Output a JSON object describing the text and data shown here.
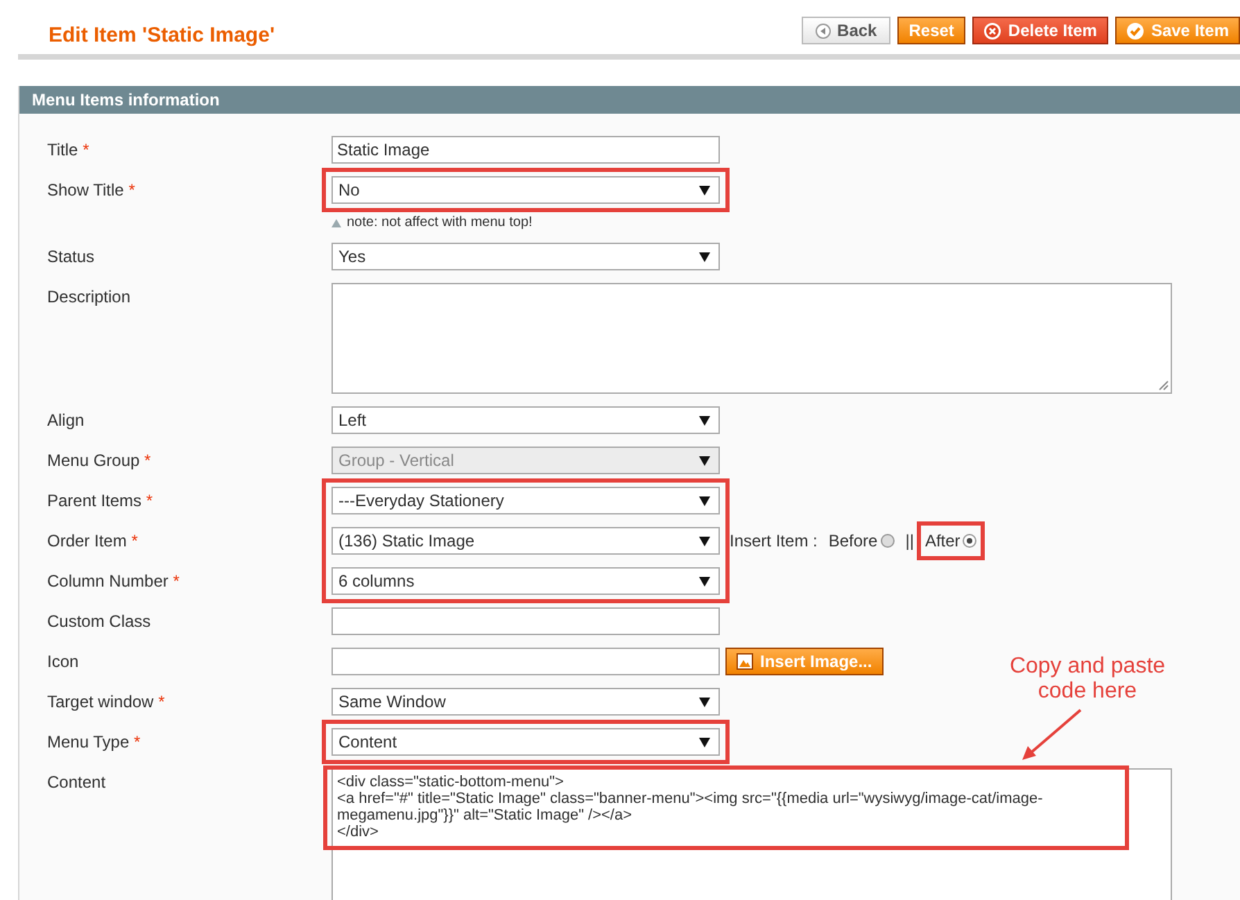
{
  "page": {
    "title": "Edit Item 'Static Image'"
  },
  "buttons": [
    {
      "label": "Back",
      "kind": "back"
    },
    {
      "label": "Reset",
      "kind": "reset"
    },
    {
      "label": "Delete Item",
      "kind": "delete"
    },
    {
      "label": "Save Item",
      "kind": "save"
    }
  ],
  "section": {
    "title": "Menu Items information"
  },
  "fields": [
    {
      "label": "Title",
      "mark": "*",
      "kind": "text",
      "value": "Static Image",
      "disabled": false,
      "highlighted": false
    },
    {
      "label": "Show Title",
      "mark": "*",
      "kind": "select",
      "value": "No",
      "disabled": false,
      "highlighted": true,
      "note": "note: not affect with menu top!"
    },
    {
      "label": "Status",
      "kind": "select",
      "value": "Yes",
      "disabled": false,
      "highlighted": false
    },
    {
      "label": "Description",
      "kind": "textarea",
      "disabled": false,
      "highlighted": false
    },
    {
      "label": "Align",
      "kind": "select",
      "value": "Left",
      "disabled": false,
      "highlighted": false
    },
    {
      "label": "Menu Group",
      "mark": "*",
      "kind": "select",
      "value": "Group - Vertical",
      "disabled": true,
      "highlighted": false
    },
    {
      "label": "Parent Items",
      "mark": "*",
      "kind": "select",
      "value": "---Everyday Stationery",
      "disabled": false,
      "highlighted": true
    },
    {
      "label": "Order Item",
      "mark": "*",
      "kind": "select",
      "value": "(136) Static Image",
      "disabled": false,
      "highlighted": true,
      "insert_position": {
        "label": "Insert Item :",
        "separator": "||",
        "options": [
          {
            "label": "Before",
            "selected": false,
            "highlighted": false
          },
          {
            "label": "After",
            "selected": true,
            "highlighted": true
          }
        ]
      }
    },
    {
      "label": "Column Number",
      "mark": "*",
      "kind": "select",
      "value": "6 columns",
      "disabled": false,
      "highlighted": true
    },
    {
      "label": "Custom Class",
      "kind": "text",
      "disabled": false,
      "highlighted": false
    },
    {
      "label": "Icon",
      "kind": "text",
      "disabled": false,
      "highlighted": false,
      "action": "Insert Image..."
    },
    {
      "label": "Target window",
      "mark": "*",
      "kind": "select",
      "value": "Same Window",
      "disabled": false,
      "highlighted": false
    },
    {
      "label": "Menu Type",
      "mark": "*",
      "kind": "select",
      "value": "Content",
      "disabled": false,
      "highlighted": true
    },
    {
      "label": "Content",
      "kind": "code",
      "value": "<div class=\"static-bottom-menu\">\n<a href=\"#\" title=\"Static Image\" class=\"banner-menu\"><img src=\"{{media url=\"wysiwyg/image-cat/image-megamenu.jpg\"}}\" alt=\"Static Image\" /></a>\n</div>",
      "disabled": false,
      "highlighted": true,
      "callout": "Copy and paste code here"
    }
  ]
}
